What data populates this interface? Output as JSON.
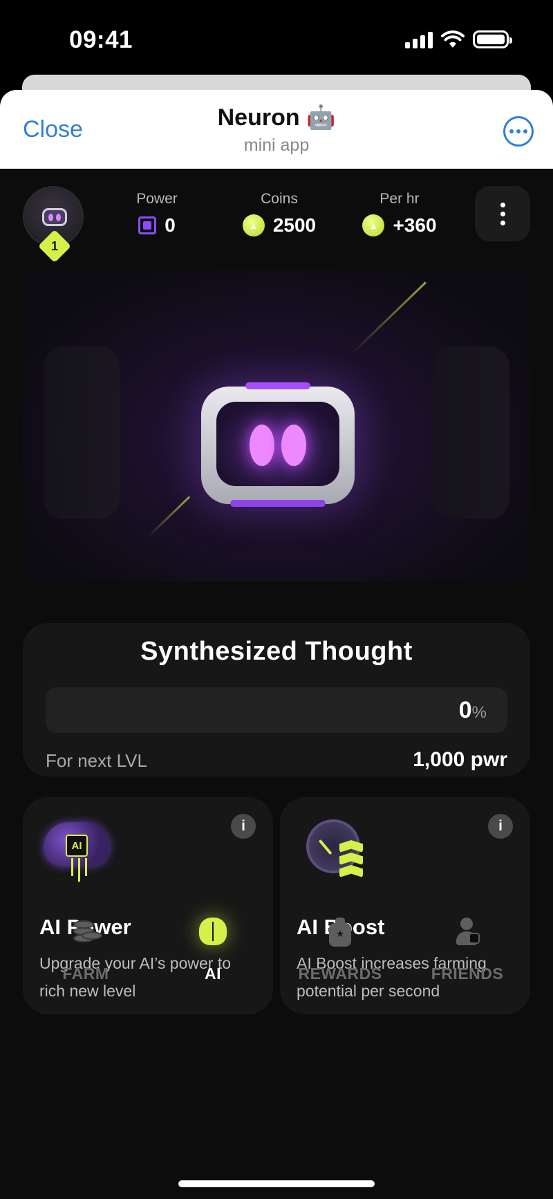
{
  "status_bar": {
    "time": "09:41"
  },
  "header": {
    "close_label": "Close",
    "title": "Neuron 🤖",
    "subtitle": "mini app"
  },
  "profile": {
    "level": "1"
  },
  "stats": [
    {
      "label": "Power",
      "value": "0",
      "icon": "chip-icon"
    },
    {
      "label": "Coins",
      "value": "2500",
      "icon": "coin-icon"
    },
    {
      "label": "Per hr",
      "value": "+360",
      "icon": "coin-icon"
    }
  ],
  "progress": {
    "title": "Synthesized Thought",
    "percent_value": "0",
    "percent_sign": "%",
    "fraction": 0,
    "next_label": "For next LVL",
    "next_value": "1,000 pwr"
  },
  "features": [
    {
      "title": "AI Power",
      "description": "Upgrade your AI’s power to rich new level",
      "icon": "brain-chip-icon",
      "chip_text": "AI"
    },
    {
      "title": "AI Boost",
      "description": "AI Boost increases farming potential per second",
      "icon": "gauge-boost-icon"
    }
  ],
  "info_glyph": "i",
  "nav": [
    {
      "label": "FARM",
      "icon": "coins-stack-icon",
      "active": false
    },
    {
      "label": "AI",
      "icon": "brain-icon",
      "active": true
    },
    {
      "label": "REWARDS",
      "icon": "reward-icon",
      "active": false
    },
    {
      "label": "FRIENDS",
      "icon": "friends-icon",
      "active": false
    }
  ],
  "colors": {
    "accent": "#d6f04a",
    "link_blue": "#2f7fd8",
    "robot_glow": "#c44dff",
    "card_bg": "#171717"
  }
}
